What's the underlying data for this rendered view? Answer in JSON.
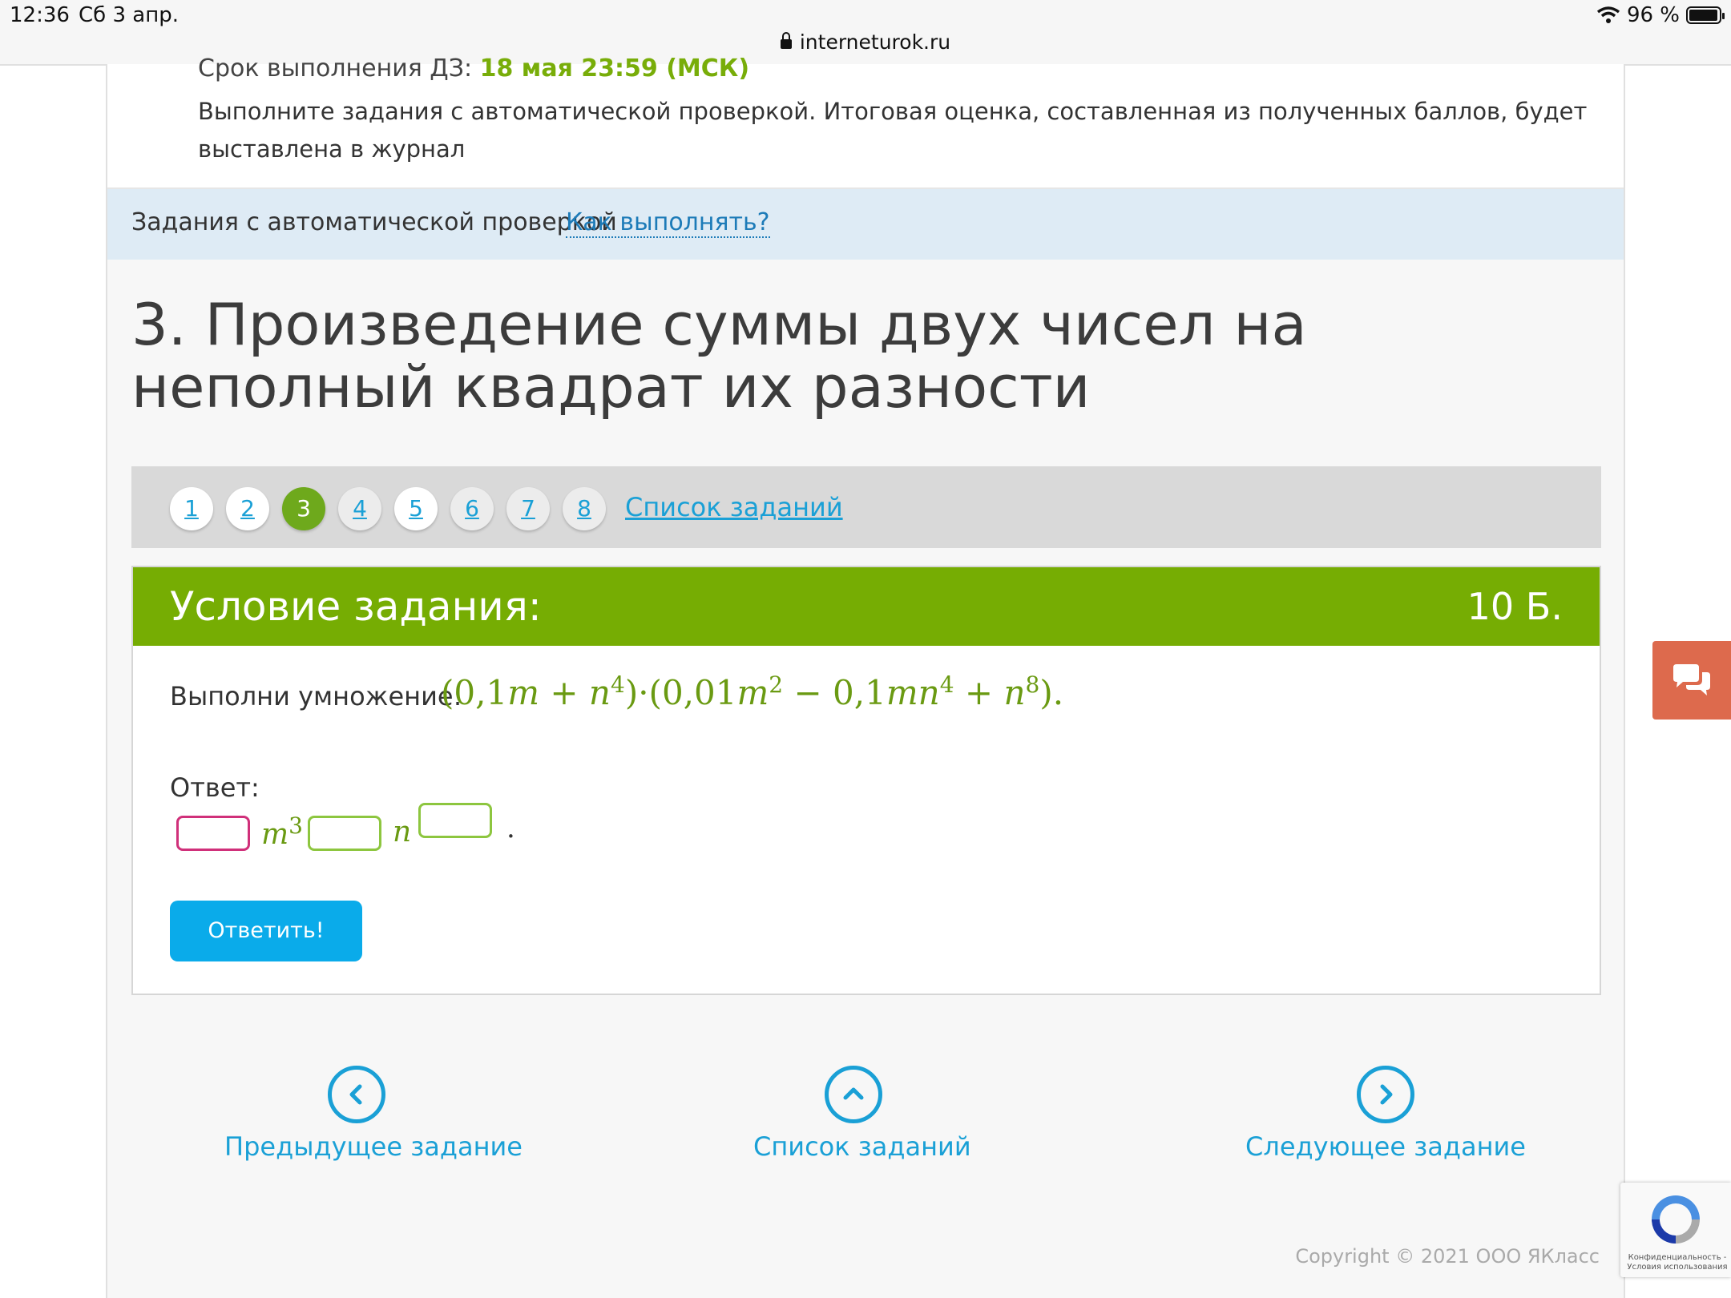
{
  "status_bar": {
    "time": "12:36",
    "date": "Сб 3 апр.",
    "battery": "96 %",
    "battery_level": 0.96,
    "url": "interneturok.ru"
  },
  "info": {
    "deadline_label": "Срок выполнения ДЗ:",
    "deadline_value": "18 мая 23:59 (МСК)",
    "description": "Выполните задания с автоматической проверкой. Итоговая оценка, составленная из полученных баллов, будет выставлена в журнал"
  },
  "auto_bar": {
    "label": "Задания с автоматической проверкой",
    "how_link": "Как выполнять?"
  },
  "task_title": "3. Произведение суммы двух чисел на неполный квадрат их разности",
  "pager": {
    "pages": [
      "1",
      "2",
      "3",
      "4",
      "5",
      "6",
      "7",
      "8"
    ],
    "active": "3",
    "list_link": "Список заданий"
  },
  "task": {
    "header": "Условие задания:",
    "points": "10 Б.",
    "instruction": "Выполни умножение:",
    "answer_label": "Ответ:",
    "answer_parts": [
      "m",
      "3",
      "n",
      "."
    ],
    "submit_label": "Ответить!"
  },
  "formula": {
    "a1": "0,1",
    "v1": "m",
    "v2": "n",
    "e1": "4",
    "b1": "0,01",
    "v3": "m",
    "e2": "2",
    "b2": "0,1",
    "v4": "mn",
    "e3": "4",
    "v5": "n",
    "e4": "8"
  },
  "nav": {
    "prev": "Предыдущее задание",
    "list": "Список заданий",
    "next": "Следующее задание"
  },
  "footer": {
    "copyright": "Copyright © 2021 ООО ЯКласс"
  },
  "recaptcha": {
    "text": "Конфиденциальность - Условия использования"
  },
  "colors": {
    "accent_green": "#76ad03",
    "link_blue": "#1aa0d6",
    "button_blue": "#0aabea",
    "chat_orange": "#dd6a4d"
  }
}
